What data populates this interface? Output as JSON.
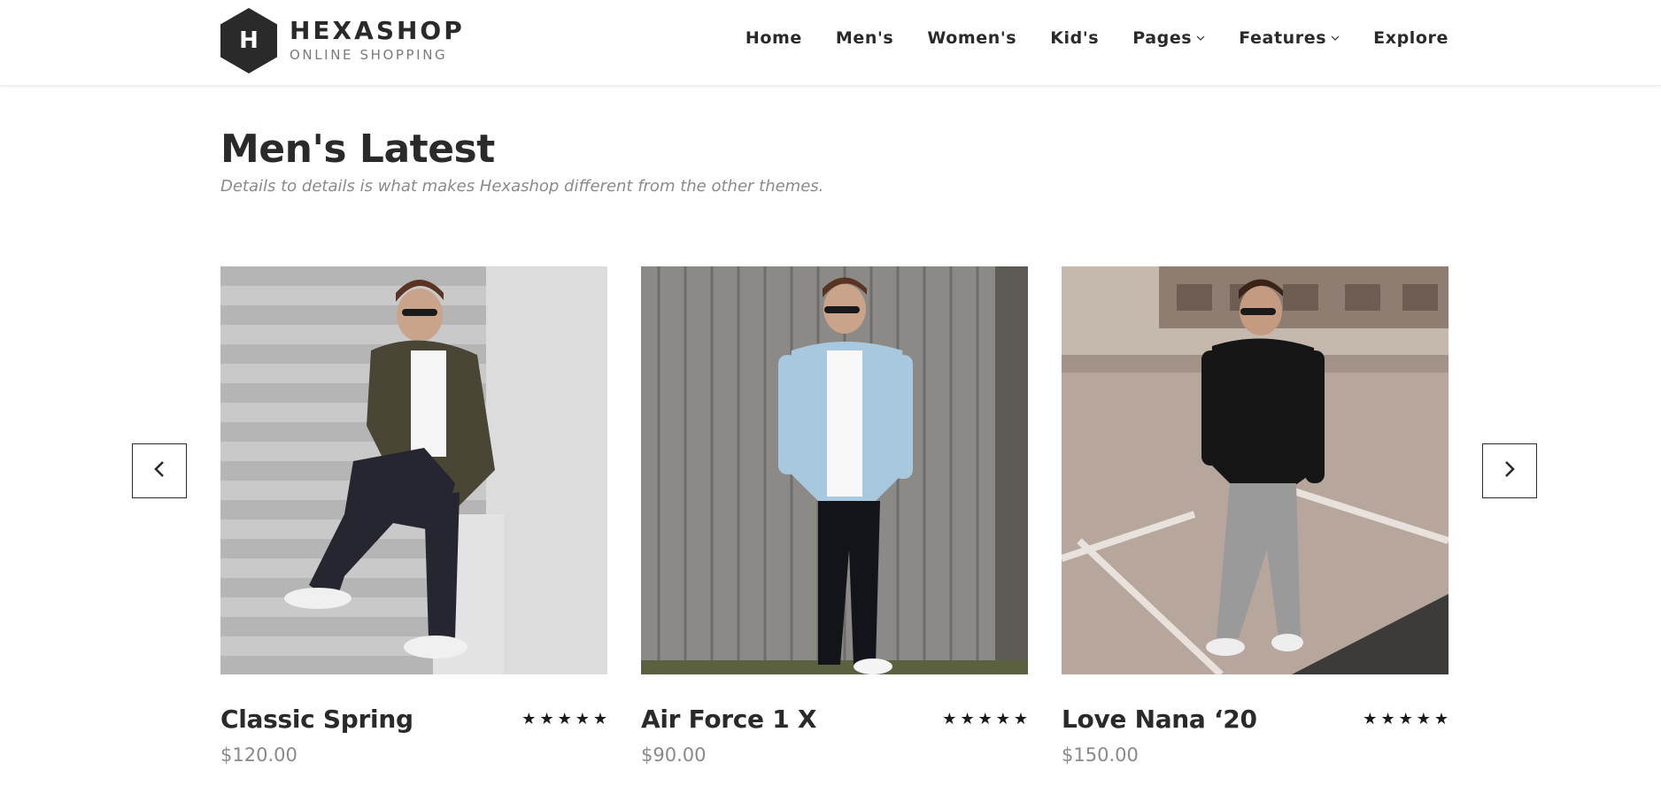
{
  "brand": {
    "logo_letter": "H",
    "title": "HEXASHOP",
    "subtitle": "ONLINE SHOPPING"
  },
  "nav": {
    "items": [
      {
        "label": "Home",
        "dropdown": false
      },
      {
        "label": "Men's",
        "dropdown": false
      },
      {
        "label": "Women's",
        "dropdown": false
      },
      {
        "label": "Kid's",
        "dropdown": false
      },
      {
        "label": "Pages",
        "dropdown": true
      },
      {
        "label": "Features",
        "dropdown": true
      },
      {
        "label": "Explore",
        "dropdown": false
      }
    ]
  },
  "section": {
    "title": "Men's Latest",
    "subtitle": "Details to details is what makes Hexashop different from the other themes."
  },
  "carousel": {
    "prev_icon": "chevron-left-icon",
    "next_icon": "chevron-right-icon"
  },
  "products": [
    {
      "name": "Classic Spring",
      "price": "$120.00",
      "rating": 5,
      "star": "★"
    },
    {
      "name": "Air Force 1 X",
      "price": "$90.00",
      "rating": 5,
      "star": "★"
    },
    {
      "name": "Love Nana ‘20",
      "price": "$150.00",
      "rating": 5,
      "star": "★"
    }
  ],
  "colors": {
    "text_dark": "#2a2a2a",
    "text_muted": "#8a8a8a",
    "background": "#ffffff"
  }
}
